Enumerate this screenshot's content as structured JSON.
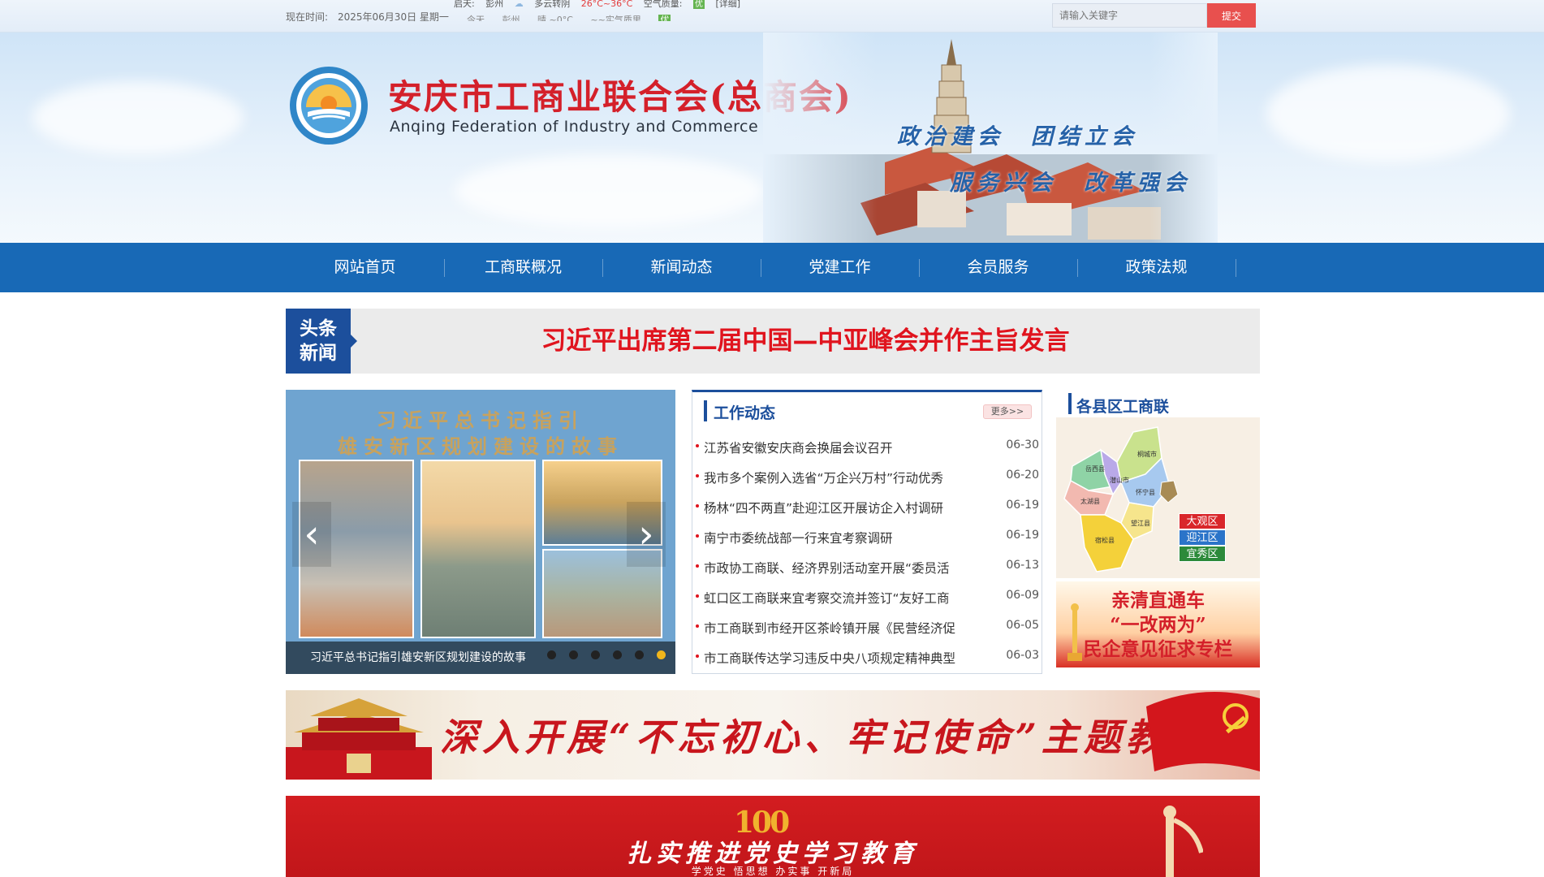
{
  "topbar": {
    "time_label": "现在时间:",
    "time_value": "2025年06月30日 星期一",
    "weather": {
      "city_label": "启天:",
      "area": "彭州",
      "condition": "多云转阴",
      "temp": "26°C~36°C",
      "aqi_label": "空气质量:",
      "aqi_value": "优",
      "detail": "[详细]"
    },
    "weather_row2": [
      "今天",
      "彭州",
      "晴 ~0°C",
      "~~实气质里",
      "优"
    ],
    "search_placeholder": "请输入关键字",
    "submit_label": "提交"
  },
  "banner": {
    "title": "安庆市工商业联合会(总商会)",
    "subtitle": "Anqing Federation of Industry and Commerce",
    "slogan1": "政治建会　团结立会",
    "slogan2": "服务兴会　改革强会"
  },
  "nav": {
    "items": [
      "网站首页",
      "工商联概况",
      "新闻动态",
      "党建工作",
      "会员服务",
      "政策法规"
    ]
  },
  "headline": {
    "tag_line1": "头条",
    "tag_line2": "新闻",
    "text": "习近平出席第二届中国—中亚峰会并作主旨发言"
  },
  "carousel": {
    "image_title1": "习近平总书记指引",
    "image_title2": "雄安新区规划建设的故事",
    "caption": "习近平总书记指引雄安新区规划建设的故事",
    "prev_arrow": "‹",
    "next_arrow": "›",
    "slide_count": 6,
    "active_slide": 6
  },
  "work": {
    "title": "工作动态",
    "more": "更多>>",
    "items": [
      {
        "title": "江苏省安徽安庆商会换届会议召开",
        "date": "06-30"
      },
      {
        "title": "我市多个案例入选省“万企兴万村”行动优秀",
        "date": "06-20"
      },
      {
        "title": "杨林“四不两直”赴迎江区开展访企入村调研",
        "date": "06-19"
      },
      {
        "title": "南宁市委统战部一行来宜考察调研",
        "date": "06-19"
      },
      {
        "title": "市政协工商联、经济界别活动室开展“委员活",
        "date": "06-13"
      },
      {
        "title": "虹口区工商联来宜考察交流并签订“友好工商",
        "date": "06-09"
      },
      {
        "title": "市工商联到市经开区茶岭镇开展《民营经济促",
        "date": "06-05"
      },
      {
        "title": "市工商联传达学习违反中央八项规定精神典型",
        "date": "06-03"
      }
    ]
  },
  "counties": {
    "title": "各县区工商联",
    "map_labels": [
      "岳西县",
      "桐城市",
      "潜山市",
      "怀宁县",
      "太湖县",
      "望江县",
      "宿松县"
    ],
    "districts": [
      {
        "name": "大观区",
        "color": "#d9262a"
      },
      {
        "name": "迎江区",
        "color": "#2b74c9"
      },
      {
        "name": "宜秀区",
        "color": "#2c8a3a"
      }
    ],
    "ad_line1": "亲清直通车",
    "ad_line2": "“一改两为”",
    "ad_line3": "民企意见征求专栏"
  },
  "edu1": {
    "text": "深入开展“不忘初心、牢记使命”主题教育"
  },
  "edu2": {
    "badge": "100",
    "text": "扎实推进党史学习教育",
    "sub": "学党史  悟思想  办实事  开新局"
  },
  "colors": {
    "nav_blue": "#1869b6",
    "headline_red": "#e0141e",
    "section_blue": "#1c4f9c",
    "submit_red": "#e8504e"
  }
}
